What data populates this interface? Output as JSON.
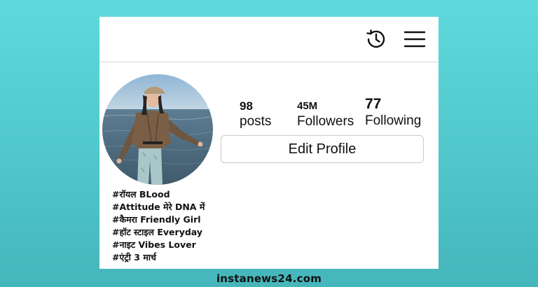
{
  "header": {
    "icons": [
      "history-icon",
      "menu-icon"
    ]
  },
  "profile": {
    "avatar": "profile-photo",
    "stats": {
      "posts": {
        "value": "98",
        "label": "posts"
      },
      "followers": {
        "value": "45M",
        "label": "Followers"
      },
      "following": {
        "value": "77",
        "label": "Following"
      }
    },
    "edit_button_label": "Edit Profile",
    "bio": [
      "#रॉयल BLood",
      "#Attitude मेरे DNA में",
      "#कैमरा Friendly Girl",
      "#हॉट स्टाइल Everyday",
      "#नाइट Vibes Lover",
      "#एंट्री 3 मार्च"
    ]
  },
  "watermark": "instanews24.com",
  "colors": {
    "background": "#4fc7cb",
    "card": "#ffffff",
    "text": "#111111",
    "border": "#c9c9c9"
  }
}
